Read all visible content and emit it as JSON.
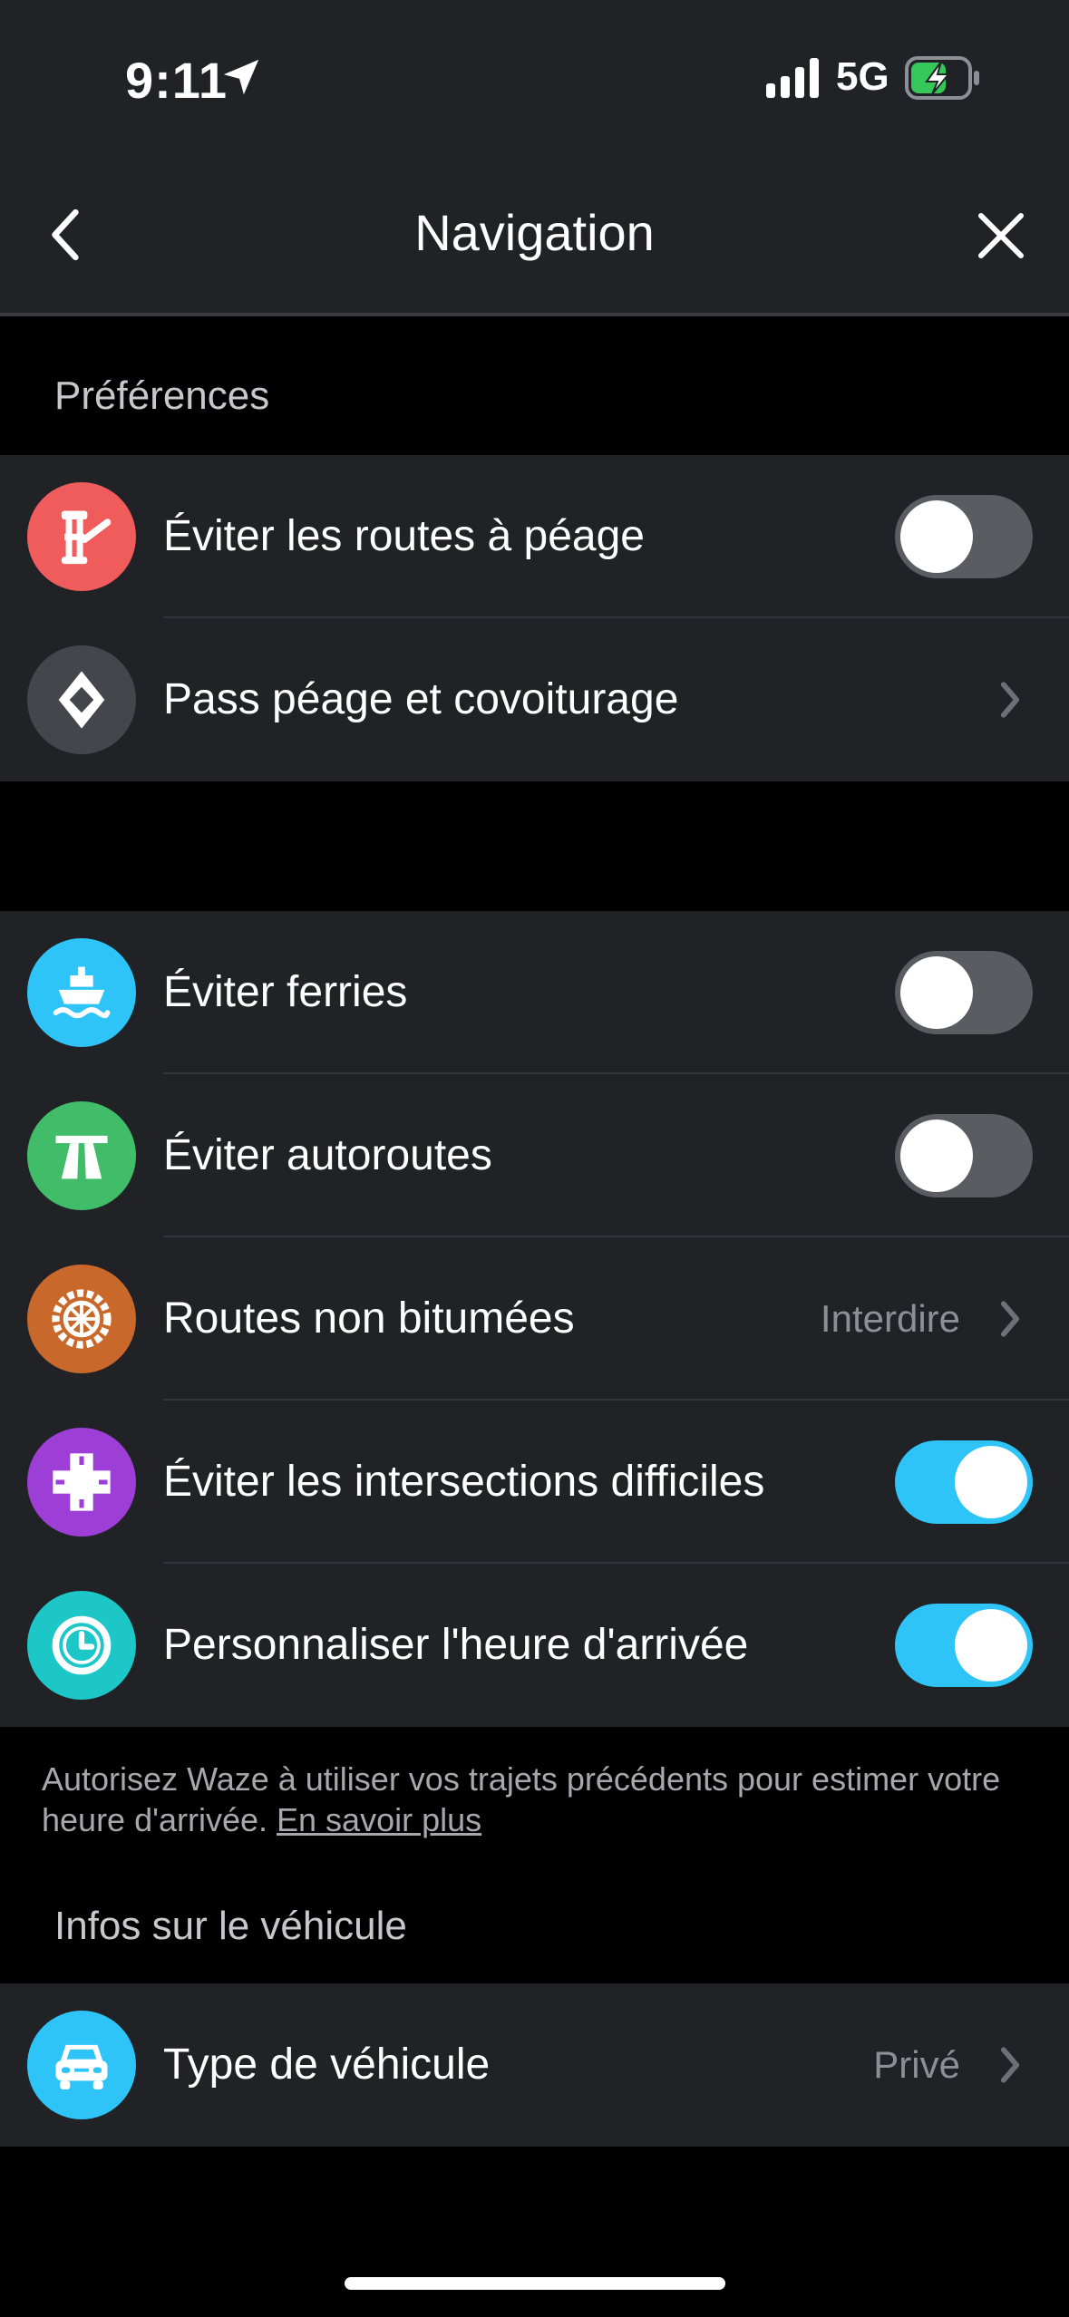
{
  "status_bar": {
    "time": "9:11",
    "network": "5G"
  },
  "header": {
    "title": "Navigation"
  },
  "sections": {
    "preferences": "Préférences",
    "vehicle_info": "Infos sur le véhicule"
  },
  "rows": {
    "toll": {
      "label": "Éviter les routes à péage",
      "enabled": false,
      "icon": "toll-booth-icon"
    },
    "toll_pass": {
      "label": "Pass péage et covoiturage",
      "icon": "diamond-icon"
    },
    "ferries": {
      "label": "Éviter ferries",
      "enabled": false,
      "icon": "ferry-icon"
    },
    "highways": {
      "label": "Éviter autoroutes",
      "enabled": false,
      "icon": "highway-icon"
    },
    "unpaved": {
      "label": "Routes non bitumées",
      "value": "Interdire",
      "icon": "wheel-icon"
    },
    "intersections": {
      "label": "Éviter les intersections difficiles",
      "enabled": true,
      "icon": "intersection-icon"
    },
    "eta": {
      "label": "Personnaliser l'heure d'arrivée",
      "enabled": true,
      "icon": "clock-icon"
    },
    "vehicle": {
      "label": "Type de véhicule",
      "value": "Privé",
      "icon": "car-icon"
    }
  },
  "footnote": {
    "text": "Autorisez Waze à utiliser vos trajets précédents pour estimer votre heure d'arrivée. ",
    "link": "En savoir plus"
  },
  "colors": {
    "toll": "#f05b5b",
    "toll_pass": "#45464b",
    "ferries": "#2ec4f7",
    "highways": "#41bd6a",
    "unpaved": "#c8682a",
    "intersections": "#9d3ed6",
    "eta": "#1ec7c7",
    "vehicle": "#2ec4f7",
    "toggle_on": "#2ec4f7"
  }
}
